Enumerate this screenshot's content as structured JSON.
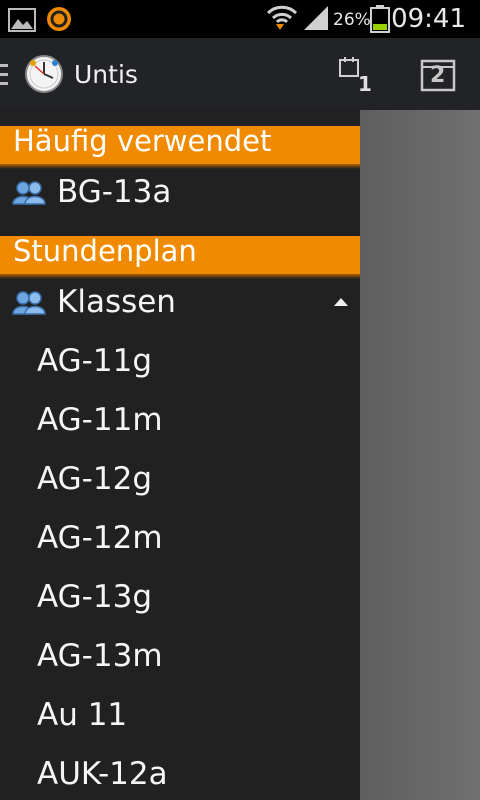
{
  "status_bar": {
    "battery_percent": "26%",
    "time": "09:41",
    "icons": [
      "gallery-icon",
      "app-notification-icon",
      "wifi-icon",
      "signal-icon",
      "battery-icon"
    ]
  },
  "action_bar": {
    "title": "Untis",
    "today_badge": "1",
    "calendar_day": "2",
    "icons": [
      "menu-icon",
      "untis-clock-logo",
      "calendar-today-icon",
      "calendar-date-icon"
    ]
  },
  "drawer": {
    "favorites_header": "Häufig verwendet",
    "favorites": [
      {
        "label": "BG-13a",
        "icon": "group-icon"
      }
    ],
    "timetable_header": "Stundenplan",
    "classes_group": {
      "label": "Klassen",
      "icon": "group-icon",
      "expanded": true
    },
    "classes": [
      "AG-11g",
      "AG-11m",
      "AG-12g",
      "AG-12m",
      "AG-13g",
      "AG-13m",
      "Au 11",
      "AUK-12a"
    ]
  },
  "colors": {
    "accent": "#f08a00",
    "drawer_bg": "#212121",
    "action_bar_bg": "#222326",
    "overlay": "#666666"
  }
}
